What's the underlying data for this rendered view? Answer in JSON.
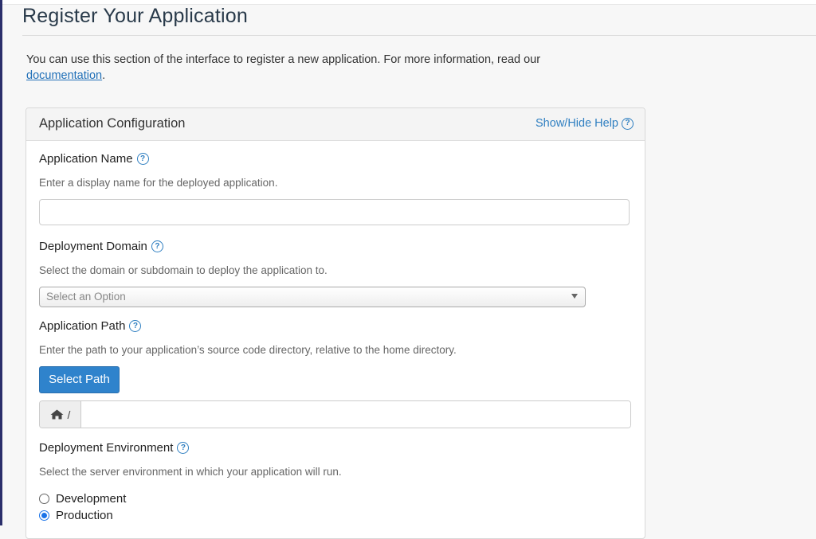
{
  "page": {
    "title": "Register Your Application",
    "intro_text": "You can use this section of the interface to register a new application. For more information, read our ",
    "intro_link": "documentation",
    "intro_end": "."
  },
  "panel": {
    "title": "Application Configuration",
    "help_toggle": "Show/Hide Help"
  },
  "fields": {
    "app_name": {
      "label": "Application Name",
      "help": "Enter a display name for the deployed application.",
      "value": ""
    },
    "domain": {
      "label": "Deployment Domain",
      "help": "Select the domain or subdomain to deploy the application to.",
      "placeholder": "Select an Option"
    },
    "path": {
      "label": "Application Path",
      "help": "Enter the path to your application’s source code directory, relative to the home directory.",
      "button": "Select Path",
      "prefix": "/",
      "value": ""
    },
    "environment": {
      "label": "Deployment Environment",
      "help": "Select the server environment in which your application will run.",
      "options": [
        "Development",
        "Production"
      ],
      "selected": "Production"
    }
  },
  "icons": {
    "help": "question-circle-icon",
    "home": "home-icon"
  },
  "colors": {
    "accent": "#2f83cc",
    "link": "#2170b8",
    "nav_rule": "#2b2f6b"
  }
}
